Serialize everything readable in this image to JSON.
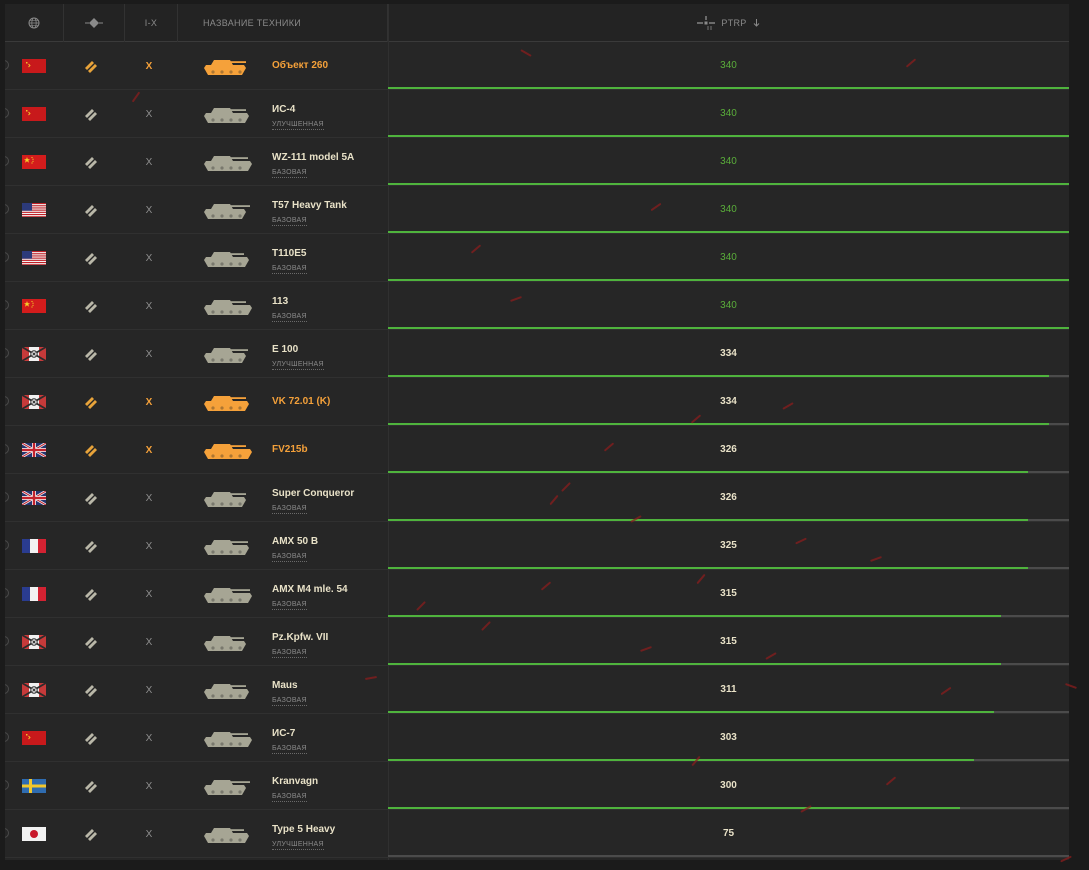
{
  "header": {
    "nation_icon": "globe-icon",
    "role_icon": "vehicle-role-icon",
    "tier_label": "I-X",
    "name_label": "НАЗВАНИЕ ТЕХНИКИ",
    "stat_icon": "sight-icon",
    "stat_label": "PTRP",
    "sort_icon": "arrow-down-icon"
  },
  "colors": {
    "premium": "#f5a13a",
    "regular_tank": "#a6a594",
    "best_value": "#5aad3a",
    "bar": "#4fb33d"
  },
  "rows": [
    {
      "nation": "ussr",
      "tier": "X",
      "name": "Объект 260",
      "sub": "",
      "premium": true,
      "value": "340",
      "bar": 1.0,
      "best": true
    },
    {
      "nation": "ussr",
      "tier": "X",
      "name": "ИС-4",
      "sub": "УЛУЧШЕННАЯ",
      "premium": false,
      "value": "340",
      "bar": 1.0,
      "best": true
    },
    {
      "nation": "china",
      "tier": "X",
      "name": "WZ-111 model 5A",
      "sub": "БАЗОВАЯ",
      "premium": false,
      "value": "340",
      "bar": 1.0,
      "best": true
    },
    {
      "nation": "usa",
      "tier": "X",
      "name": "T57 Heavy Tank",
      "sub": "БАЗОВАЯ",
      "premium": false,
      "value": "340",
      "bar": 1.0,
      "best": true
    },
    {
      "nation": "usa",
      "tier": "X",
      "name": "T110E5",
      "sub": "БАЗОВАЯ",
      "premium": false,
      "value": "340",
      "bar": 1.0,
      "best": true
    },
    {
      "nation": "china",
      "tier": "X",
      "name": "113",
      "sub": "БАЗОВАЯ",
      "premium": false,
      "value": "340",
      "bar": 1.0,
      "best": true
    },
    {
      "nation": "germany",
      "tier": "X",
      "name": "E 100",
      "sub": "УЛУЧШЕННАЯ",
      "premium": false,
      "value": "334",
      "bar": 0.97,
      "best": false
    },
    {
      "nation": "germany",
      "tier": "X",
      "name": "VK 72.01 (K)",
      "sub": "",
      "premium": true,
      "value": "334",
      "bar": 0.97,
      "best": false
    },
    {
      "nation": "uk",
      "tier": "X",
      "name": "FV215b",
      "sub": "",
      "premium": true,
      "value": "326",
      "bar": 0.94,
      "best": false
    },
    {
      "nation": "uk",
      "tier": "X",
      "name": "Super Conqueror",
      "sub": "БАЗОВАЯ",
      "premium": false,
      "value": "326",
      "bar": 0.94,
      "best": false
    },
    {
      "nation": "france",
      "tier": "X",
      "name": "AMX 50 B",
      "sub": "БАЗОВАЯ",
      "premium": false,
      "value": "325",
      "bar": 0.94,
      "best": false
    },
    {
      "nation": "france",
      "tier": "X",
      "name": "AMX M4 mle. 54",
      "sub": "БАЗОВАЯ",
      "premium": false,
      "value": "315",
      "bar": 0.9,
      "best": false
    },
    {
      "nation": "germany",
      "tier": "X",
      "name": "Pz.Kpfw. VII",
      "sub": "БАЗОВАЯ",
      "premium": false,
      "value": "315",
      "bar": 0.9,
      "best": false
    },
    {
      "nation": "germany",
      "tier": "X",
      "name": "Maus",
      "sub": "БАЗОВАЯ",
      "premium": false,
      "value": "311",
      "bar": 0.89,
      "best": false
    },
    {
      "nation": "ussr",
      "tier": "X",
      "name": "ИС-7",
      "sub": "БАЗОВАЯ",
      "premium": false,
      "value": "303",
      "bar": 0.86,
      "best": false
    },
    {
      "nation": "sweden",
      "tier": "X",
      "name": "Kranvagn",
      "sub": "БАЗОВАЯ",
      "premium": false,
      "value": "300",
      "bar": 0.84,
      "best": false
    },
    {
      "nation": "japan",
      "tier": "X",
      "name": "Type 5 Heavy",
      "sub": "УЛУЧШЕННАЯ",
      "premium": false,
      "value": "75",
      "bar": 0.0,
      "best": false
    }
  ]
}
